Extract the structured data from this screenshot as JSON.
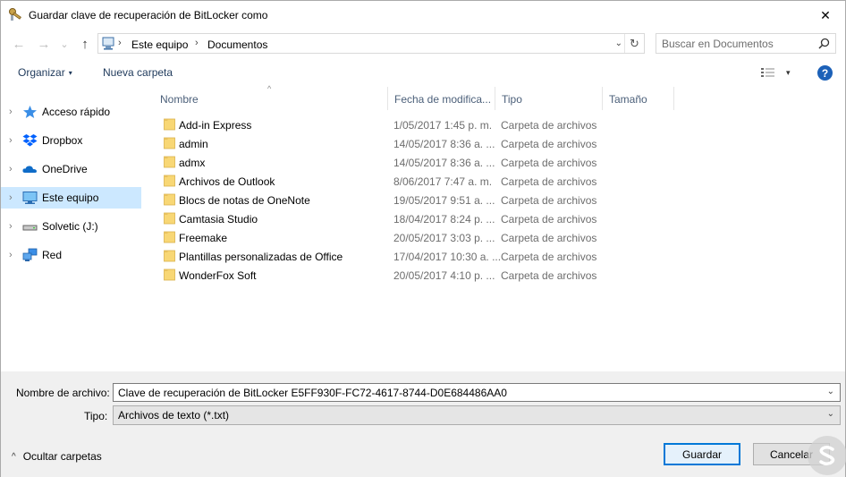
{
  "window": {
    "title": "Guardar clave de recuperación de BitLocker como",
    "close_glyph": "✕"
  },
  "nav": {
    "back_glyph": "←",
    "forward_glyph": "→",
    "recent_glyph": "⌄",
    "up_glyph": "↑"
  },
  "address": {
    "sep": "›",
    "crumbs": [
      "Este equipo",
      "Documentos"
    ],
    "dropdown_glyph": "⌄",
    "refresh_glyph": "↻"
  },
  "search": {
    "placeholder": "Buscar en Documentos"
  },
  "toolbar": {
    "organize_label": "Organizar",
    "new_folder_label": "Nueva carpeta",
    "caret": "▾",
    "help_glyph": "?"
  },
  "sidebar": {
    "chevron": "›",
    "items": [
      {
        "label": "Acceso rápido",
        "icon": "star-icon",
        "selected": false
      },
      {
        "label": "Dropbox",
        "icon": "dropbox-icon",
        "selected": false
      },
      {
        "label": "OneDrive",
        "icon": "cloud-icon",
        "selected": false
      },
      {
        "label": "Este equipo",
        "icon": "computer-icon",
        "selected": true
      },
      {
        "label": "Solvetic (J:)",
        "icon": "drive-icon",
        "selected": false
      },
      {
        "label": "Red",
        "icon": "network-icon",
        "selected": false
      }
    ]
  },
  "columns": {
    "name": "Nombre",
    "date": "Fecha de modifica...",
    "type": "Tipo",
    "size": "Tamaño",
    "sort_glyph": "^"
  },
  "files": [
    {
      "name": "Add-in Express",
      "date": "1/05/2017 1:45 p. m.",
      "type": "Carpeta de archivos"
    },
    {
      "name": "admin",
      "date": "14/05/2017 8:36 a. ...",
      "type": "Carpeta de archivos"
    },
    {
      "name": "admx",
      "date": "14/05/2017 8:36 a. ...",
      "type": "Carpeta de archivos"
    },
    {
      "name": "Archivos de Outlook",
      "date": "8/06/2017 7:47 a. m.",
      "type": "Carpeta de archivos"
    },
    {
      "name": "Blocs de notas de OneNote",
      "date": "19/05/2017 9:51 a. ...",
      "type": "Carpeta de archivos"
    },
    {
      "name": "Camtasia Studio",
      "date": "18/04/2017 8:24 p. ...",
      "type": "Carpeta de archivos"
    },
    {
      "name": "Freemake",
      "date": "20/05/2017 3:03 p. ...",
      "type": "Carpeta de archivos"
    },
    {
      "name": "Plantillas personalizadas de Office",
      "date": "17/04/2017 10:30 a. ...",
      "type": "Carpeta de archivos"
    },
    {
      "name": "WonderFox Soft",
      "date": "20/05/2017 4:10 p. ...",
      "type": "Carpeta de archivos"
    }
  ],
  "form": {
    "filename_label": "Nombre de archivo:",
    "filename_value": "Clave de recuperación de BitLocker E5FF930F-FC72-4617-8744-D0E684486AA0",
    "type_label": "Tipo:",
    "type_value": "Archivos de texto (*.txt)",
    "dropdown_glyph": "⌄",
    "hide_folders_label": "Ocultar carpetas",
    "hide_glyph": "^",
    "save_label": "Guardar",
    "cancel_label": "Cancelar"
  },
  "colors": {
    "selection": "#cce8ff",
    "folder": "#f8d775",
    "accent": "#0078d7",
    "help": "#1c61b8"
  }
}
